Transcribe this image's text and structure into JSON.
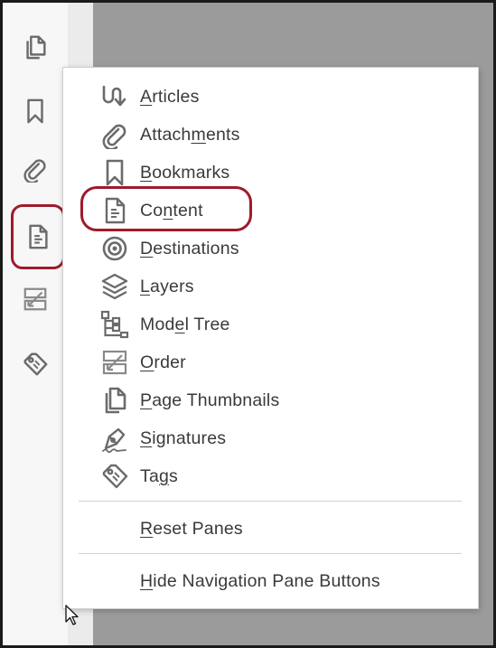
{
  "colors": {
    "highlight": "#9e1b2c",
    "icon": "#6b6b6b",
    "text": "#3a3a3a",
    "document_bg": "#9b9b9b"
  },
  "nav_buttons": [
    {
      "icon": "page-thumbnails-icon"
    },
    {
      "icon": "bookmark-icon"
    },
    {
      "icon": "attachment-icon"
    },
    {
      "icon": "content-icon",
      "active": true
    },
    {
      "icon": "order-icon"
    },
    {
      "icon": "tag-icon"
    }
  ],
  "menu": {
    "items": [
      {
        "label": "Articles",
        "mnemonic": "A",
        "icon": "articles-icon"
      },
      {
        "label": "Attachments",
        "mnemonic": "m",
        "icon": "attachment-icon"
      },
      {
        "label": "Bookmarks",
        "mnemonic": "B",
        "icon": "bookmark-icon"
      },
      {
        "label": "Content",
        "mnemonic": "n",
        "icon": "content-icon",
        "highlighted": true
      },
      {
        "label": "Destinations",
        "mnemonic": "D",
        "icon": "destinations-icon"
      },
      {
        "label": "Layers",
        "mnemonic": "L",
        "icon": "layers-icon"
      },
      {
        "label": "Model Tree",
        "mnemonic": "e",
        "icon": "model-tree-icon"
      },
      {
        "label": "Order",
        "mnemonic": "O",
        "icon": "order-icon"
      },
      {
        "label": "Page Thumbnails",
        "mnemonic": "P",
        "icon": "page-thumbnails-icon"
      },
      {
        "label": "Signatures",
        "mnemonic": "S",
        "icon": "signatures-icon"
      },
      {
        "label": "Tags",
        "mnemonic": "g",
        "icon": "tag-icon"
      }
    ],
    "reset_panes": {
      "label": "Reset Panes",
      "mnemonic": "R"
    },
    "hide_buttons": {
      "label": "Hide Navigation Pane Buttons",
      "mnemonic": "H"
    }
  }
}
